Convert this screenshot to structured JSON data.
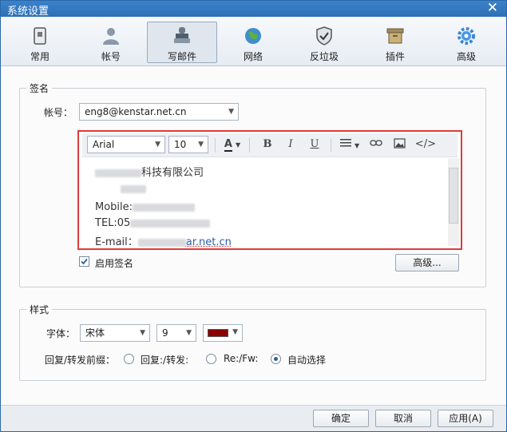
{
  "window": {
    "title": "系统设置",
    "close_label": "✕"
  },
  "tabs": [
    {
      "id": "general",
      "label": "常用",
      "icon": "phone-icon"
    },
    {
      "id": "account",
      "label": "帐号",
      "icon": "user-icon"
    },
    {
      "id": "compose",
      "label": "写邮件",
      "icon": "stamp-icon",
      "active": true
    },
    {
      "id": "network",
      "label": "网络",
      "icon": "globe-icon"
    },
    {
      "id": "spam",
      "label": "反垃圾",
      "icon": "shield-icon"
    },
    {
      "id": "plugins",
      "label": "插件",
      "icon": "box-icon"
    },
    {
      "id": "advanced",
      "label": "高级",
      "icon": "gear-icon"
    }
  ],
  "signature": {
    "group_title": "签名",
    "account_label": "帐号：",
    "account_value": "eng8@kenstar.net.cn",
    "toolbar": {
      "font_value": "Arial",
      "size_value": "10",
      "bold": "B",
      "italic": "I",
      "underline": "U",
      "code": "</>",
      "text_color_glyph": "A"
    },
    "body": {
      "line1": "科技有限公司",
      "line3": "Mobile:",
      "line4": "TEL:05",
      "line5_label": "E-mail：",
      "line5_domain": "ar.net.cn"
    },
    "enable_label": "启用签名",
    "enable_checked": true,
    "advanced_button": "高级..."
  },
  "style": {
    "group_title": "样式",
    "font_label": "字体：",
    "font_value": "宋体",
    "size_value": "9",
    "color_value": "#8b0000",
    "prefix_label": "回复/转发前缀：",
    "options": [
      "回复:/转发:",
      "Re:/Fw:",
      "自动选择"
    ],
    "selected_option": 2
  },
  "footer": {
    "ok": "确定",
    "cancel": "取消",
    "apply": "应用(A)"
  }
}
